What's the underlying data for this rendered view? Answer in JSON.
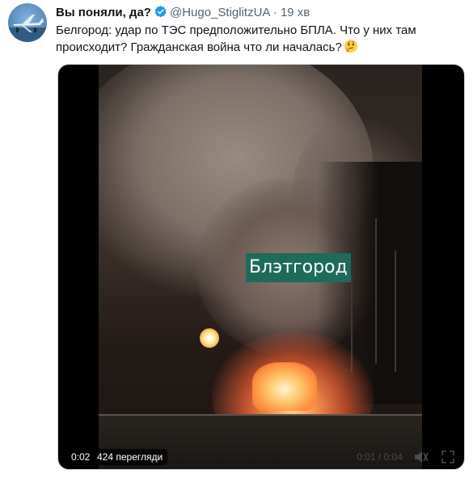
{
  "tweet": {
    "author_name": "Вы поняли, да?",
    "handle": "@Hugo_StiglitzUA",
    "separator": "·",
    "time": "19 хв",
    "text": "Белгород: удар по ТЭС предположительно БПЛА. Что у них там происходит? Гражданская война что ли началась?"
  },
  "icons": {
    "avatar": "airplane-avatar",
    "verified": "verified-badge-icon",
    "emoji": "thinking-face-emoji",
    "volume": "volume-icon",
    "fullscreen": "fullscreen-icon"
  },
  "colors": {
    "verified": "#1d9bf0",
    "label_bg": "#1d6b5b"
  },
  "video": {
    "overlay_text": "Блэтгород",
    "current_time": "0:02",
    "views": "424 перегляди",
    "time_display": "0:01 / 0:04"
  }
}
